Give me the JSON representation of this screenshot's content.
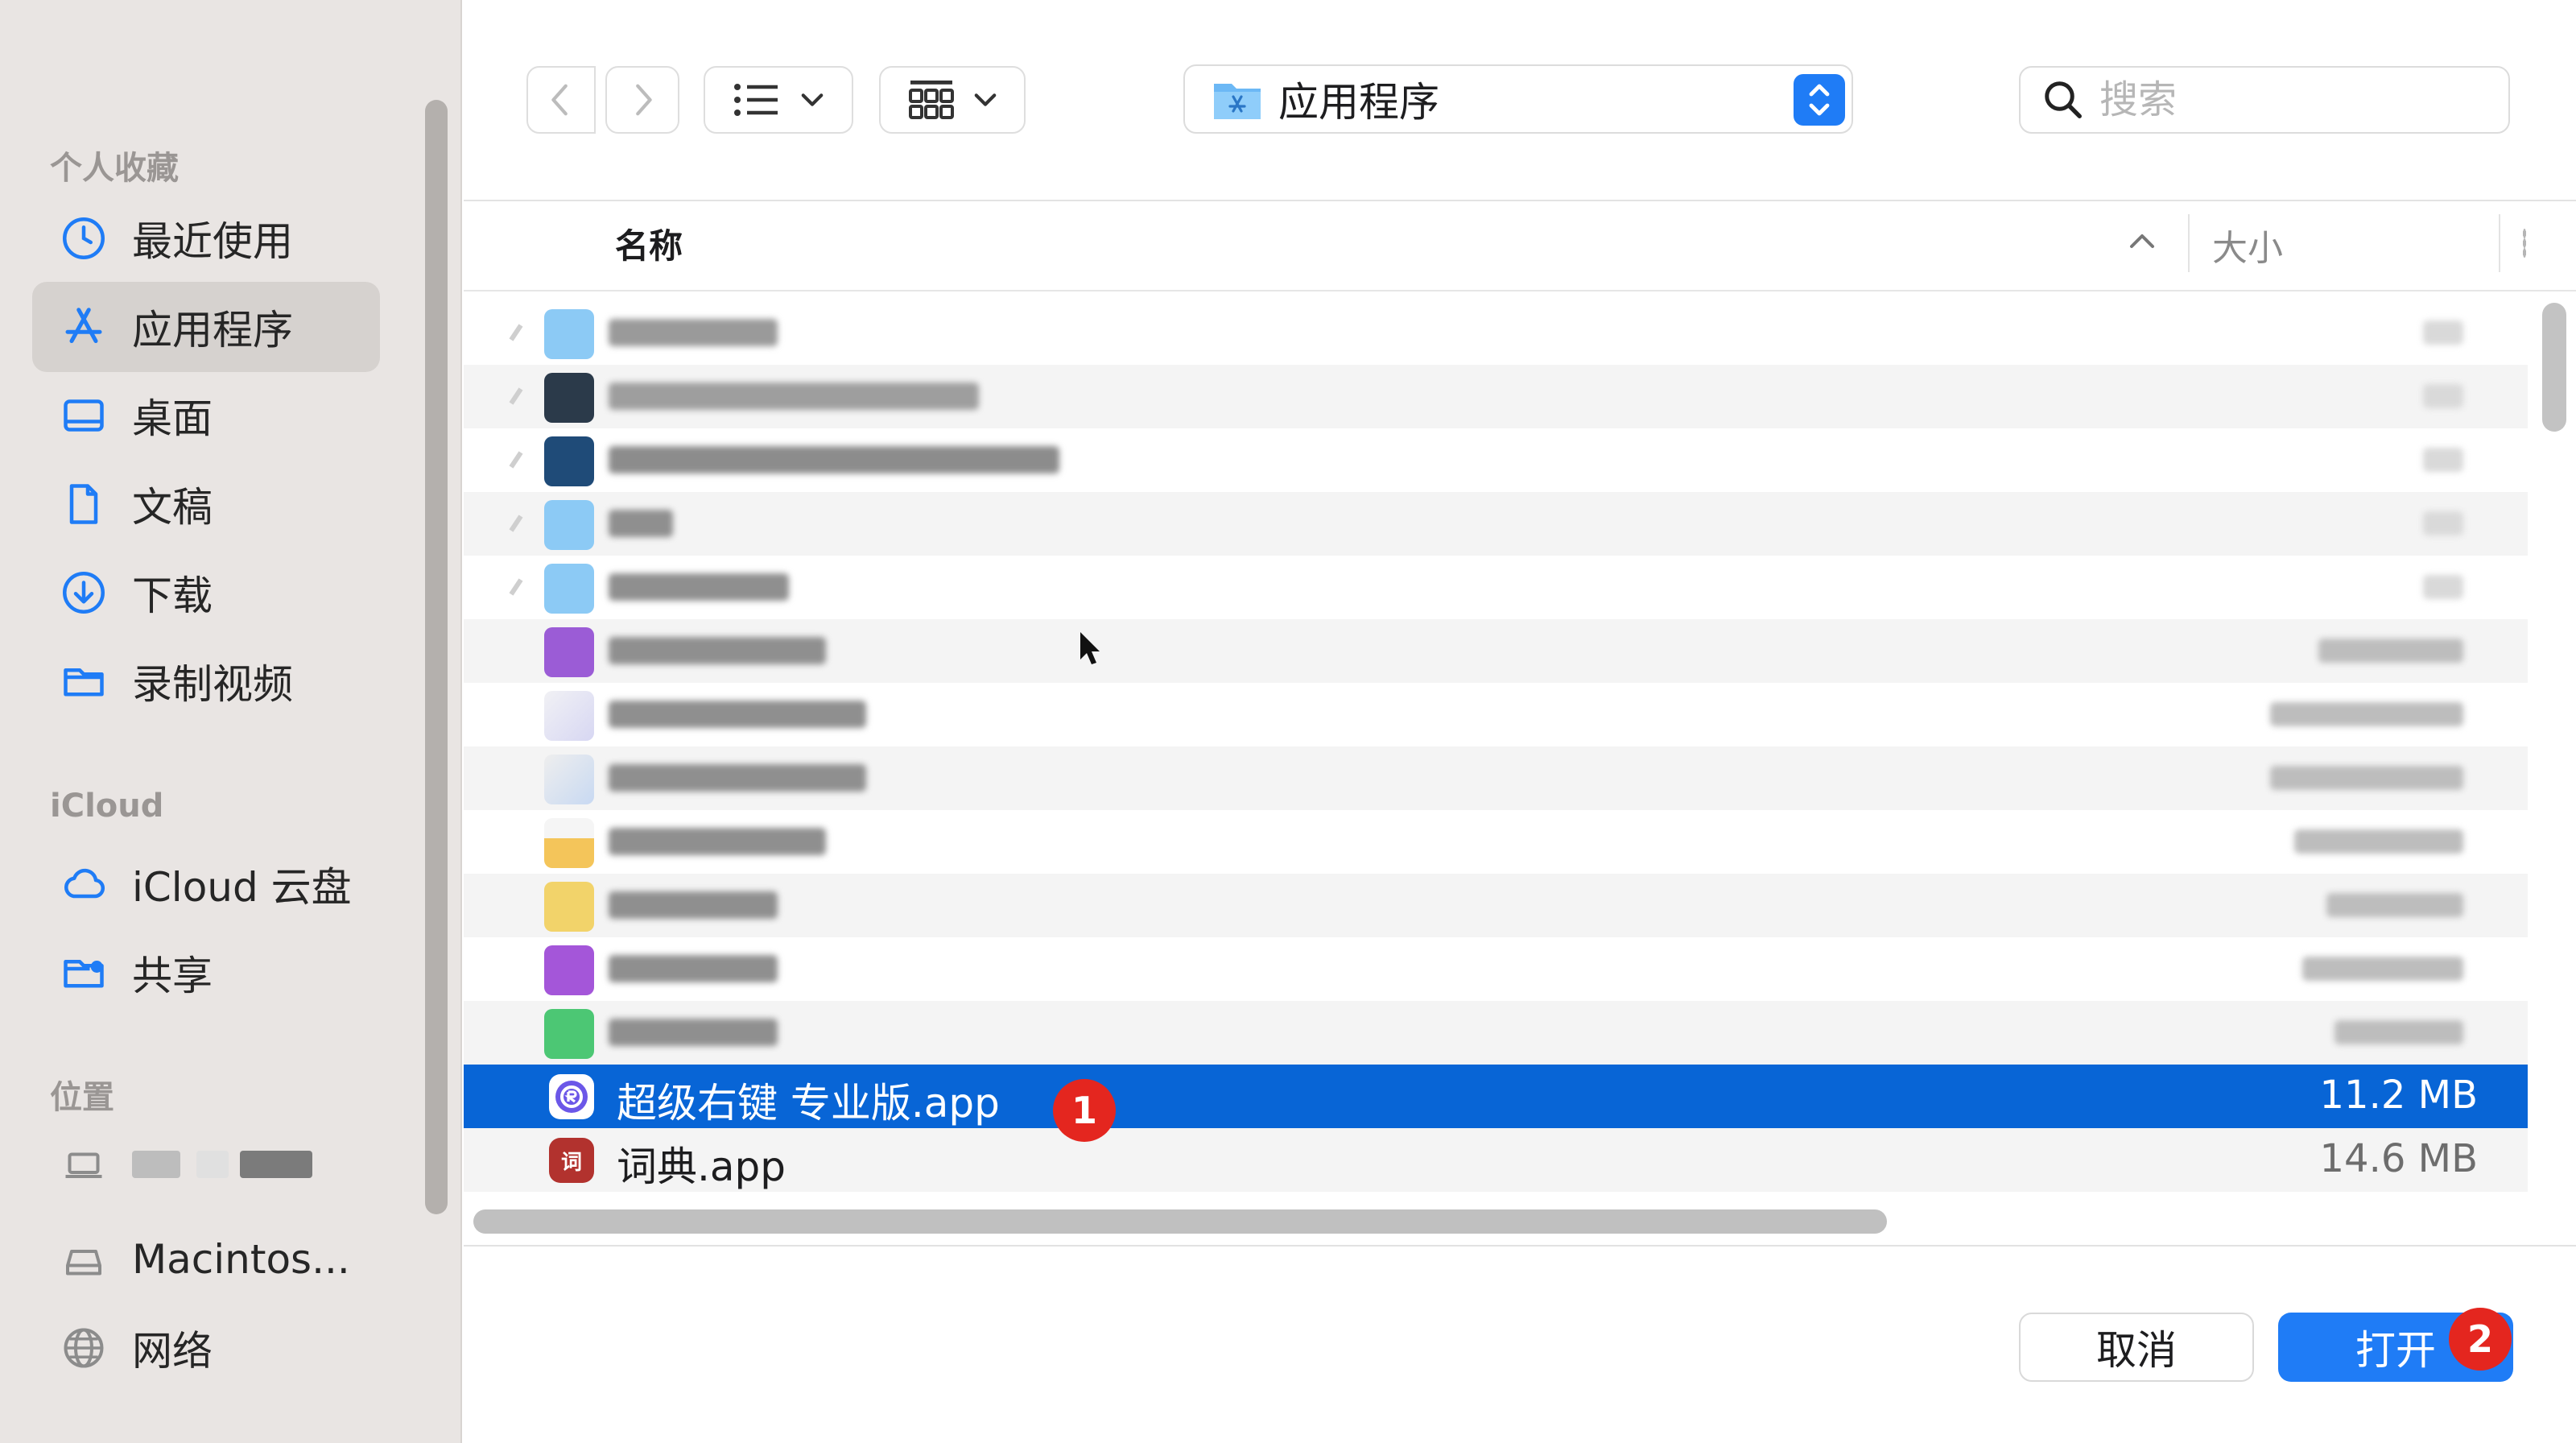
{
  "sidebar": {
    "favorites_header": "个人收藏",
    "favorites": [
      {
        "label": "最近使用",
        "icon": "clock-icon"
      },
      {
        "label": "应用程序",
        "icon": "app-store-icon"
      },
      {
        "label": "桌面",
        "icon": "desktop-icon"
      },
      {
        "label": "文稿",
        "icon": "document-icon"
      },
      {
        "label": "下载",
        "icon": "download-icon"
      },
      {
        "label": "录制视频",
        "icon": "folder-icon"
      }
    ],
    "icloud_header": "iCloud",
    "icloud": [
      {
        "label": "iCloud 云盘",
        "icon": "cloud-icon"
      },
      {
        "label": "共享",
        "icon": "shared-folder-icon"
      }
    ],
    "locations_header": "位置",
    "locations": [
      {
        "label": "Macintos...",
        "icon": "disk-icon"
      },
      {
        "label": "网络",
        "icon": "globe-icon"
      }
    ]
  },
  "toolbar": {
    "path_label": "应用程序",
    "search_placeholder": "搜索"
  },
  "list": {
    "col_name": "名称",
    "col_size": "大小",
    "visible_rows": [
      {
        "name": "超级右键 专业版.app",
        "size": "11.2 MB",
        "selected": true
      },
      {
        "name": "词典.app",
        "size": "14.6 MB",
        "selected": false
      }
    ]
  },
  "badges": {
    "one": "1",
    "two": "2"
  },
  "buttons": {
    "cancel": "取消",
    "open": "打开"
  },
  "colors": {
    "accent": "#1f7cf6",
    "selection": "#0865d6",
    "badge": "#e4261f"
  }
}
